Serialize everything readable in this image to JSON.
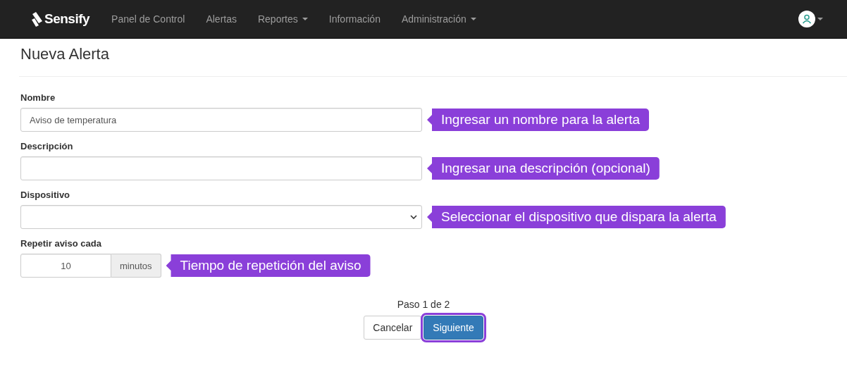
{
  "navbar": {
    "brand": "Sensify",
    "items": [
      {
        "label": "Panel de Control",
        "dropdown": false
      },
      {
        "label": "Alertas",
        "dropdown": false
      },
      {
        "label": "Reportes",
        "dropdown": true
      },
      {
        "label": "Información",
        "dropdown": false
      },
      {
        "label": "Administración",
        "dropdown": true
      }
    ]
  },
  "page_title": "Nueva Alerta",
  "fields": [
    {
      "kind": "text",
      "label": "Nombre",
      "value": "Aviso de temperatura",
      "callout": "Ingresar un nombre para la alerta"
    },
    {
      "kind": "text",
      "label": "Descripción",
      "callout": "Ingresar una descripción (opcional)"
    },
    {
      "kind": "select",
      "label": "Dispositivo",
      "callout": "Seleccionar el dispositivo que dispara la alerta"
    },
    {
      "kind": "addon",
      "label": "Repetir aviso cada",
      "value": "10",
      "addon": "minutos",
      "callout": "Tiempo de repetición del aviso"
    }
  ],
  "step": "Paso 1 de 2",
  "buttons": [
    {
      "label": "Cancelar",
      "kind": "default",
      "highlighted": false
    },
    {
      "label": "Siguiente",
      "kind": "primary",
      "highlighted": true
    }
  ]
}
